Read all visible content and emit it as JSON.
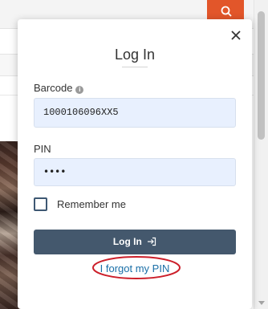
{
  "modal": {
    "title": "Log In",
    "barcode_label": "Barcode",
    "barcode_value": "1000106096XX5",
    "pin_label": "PIN",
    "pin_value": "••••",
    "remember_label": "Remember me",
    "login_label": "Log In",
    "forgot_link": "I forgot my PIN"
  },
  "icons": {
    "close": "close-icon",
    "info": "info-icon",
    "search": "search-icon",
    "login": "login-icon"
  },
  "colors": {
    "accent_search": "#e2562a",
    "login_button": "#44586d",
    "link": "#1a6fa7",
    "annotation": "#cc1f2a",
    "input_fill": "#e8f0fe"
  }
}
